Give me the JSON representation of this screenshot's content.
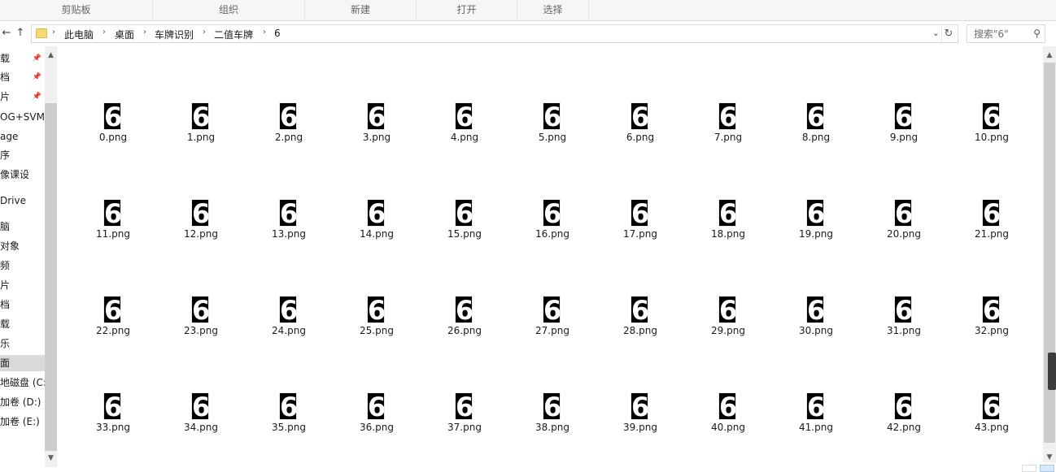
{
  "ribbon": {
    "groups": [
      "剪贴板",
      "组织",
      "新建",
      "打开",
      "选择"
    ]
  },
  "nav": {
    "back": "←",
    "up": "↑",
    "dropdown": "⌄",
    "refresh": "↻"
  },
  "address": {
    "crumbs": [
      "此电脑",
      "桌面",
      "车牌识别",
      "二值车牌",
      "6"
    ],
    "separator": "›"
  },
  "search": {
    "placeholder": "搜索\"6\"",
    "icon": "search-icon"
  },
  "sidebar": {
    "items": [
      {
        "label": "载",
        "pinned": true
      },
      {
        "label": "档",
        "pinned": true
      },
      {
        "label": "片",
        "pinned": true
      },
      {
        "label": "OG+SVM数",
        "pinned": false
      },
      {
        "label": "age",
        "pinned": false
      },
      {
        "label": "序",
        "pinned": false
      },
      {
        "label": "像课设",
        "pinned": false
      },
      {
        "label": "Drive",
        "pinned": false
      },
      {
        "label": "脑",
        "pinned": false
      },
      {
        "label": "对象",
        "pinned": false
      },
      {
        "label": "频",
        "pinned": false
      },
      {
        "label": "片",
        "pinned": false
      },
      {
        "label": "档",
        "pinned": false
      },
      {
        "label": "载",
        "pinned": false
      },
      {
        "label": "乐",
        "pinned": false
      },
      {
        "label": "面",
        "pinned": false,
        "selected": true
      },
      {
        "label": "地磁盘 (C:",
        "pinned": false
      },
      {
        "label": "加卷 (D:)",
        "pinned": false
      },
      {
        "label": "加卷 (E:)",
        "pinned": false
      },
      {
        "label": "",
        "pinned": false
      }
    ]
  },
  "files": {
    "glyph": "6",
    "names": [
      "0.png",
      "1.png",
      "2.png",
      "3.png",
      "4.png",
      "5.png",
      "6.png",
      "7.png",
      "8.png",
      "9.png",
      "10.png",
      "11.png",
      "12.png",
      "13.png",
      "14.png",
      "15.png",
      "16.png",
      "17.png",
      "18.png",
      "19.png",
      "20.png",
      "21.png",
      "22.png",
      "23.png",
      "24.png",
      "25.png",
      "26.png",
      "27.png",
      "28.png",
      "29.png",
      "30.png",
      "31.png",
      "32.png",
      "33.png",
      "34.png",
      "35.png",
      "36.png",
      "37.png",
      "38.png",
      "39.png",
      "40.png",
      "41.png",
      "42.png",
      "43.png"
    ]
  },
  "scroll": {
    "up": "▲",
    "down": "▼"
  },
  "colors": {
    "ribbon_bg": "#f5f6f7",
    "selected_bg": "#d9d9d9",
    "folder": "#f8d775"
  }
}
